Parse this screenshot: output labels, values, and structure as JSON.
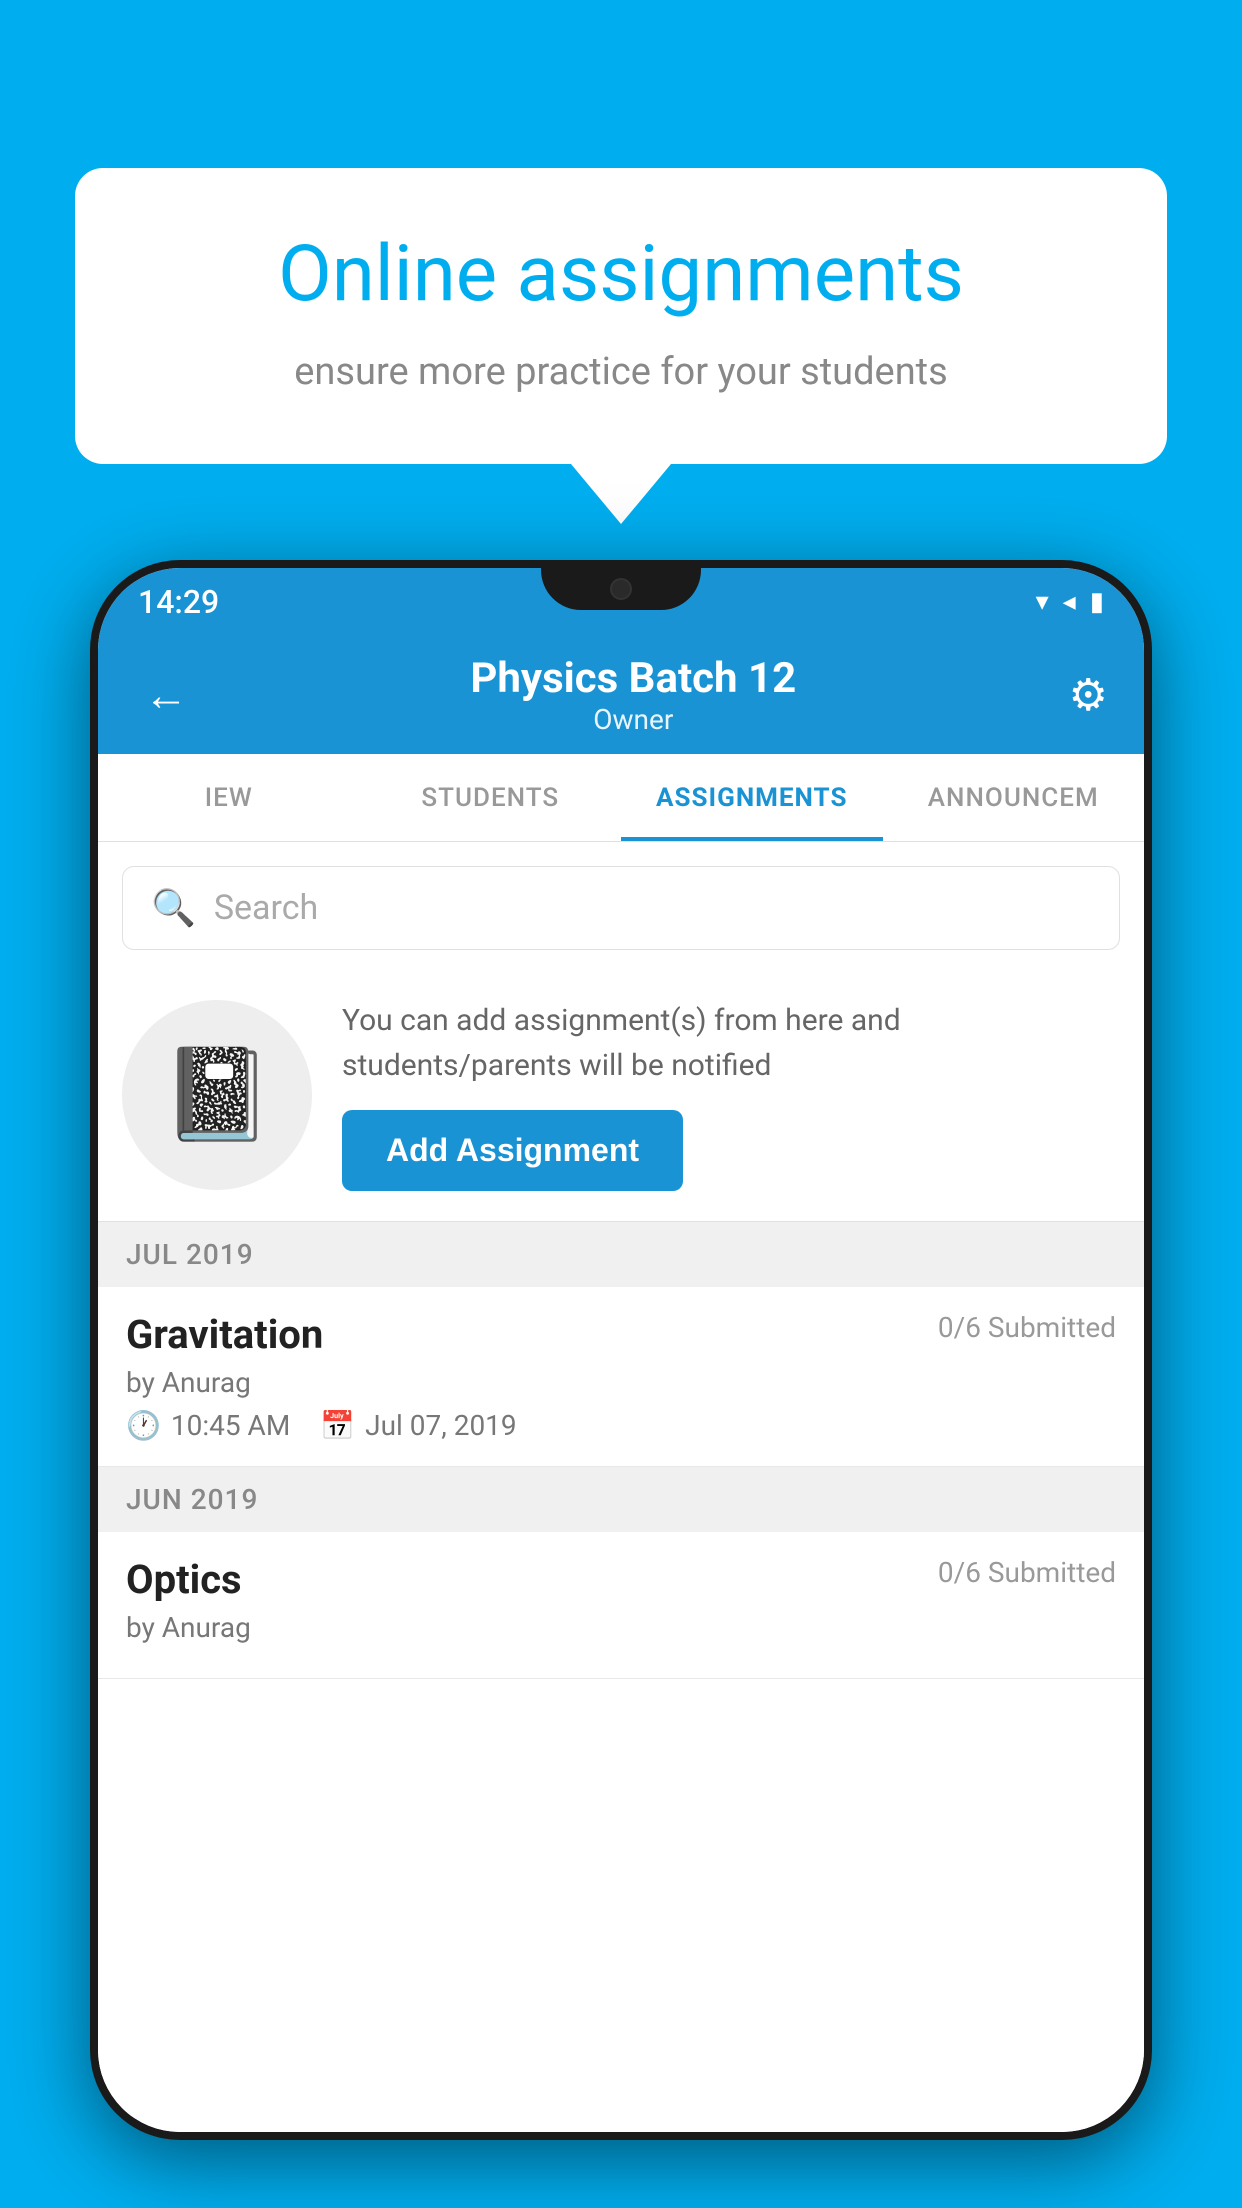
{
  "background_color": "#00AEEF",
  "speech_bubble": {
    "title": "Online assignments",
    "subtitle": "ensure more practice for your students"
  },
  "status_bar": {
    "time": "14:29",
    "icons": [
      "wifi",
      "signal",
      "battery"
    ]
  },
  "app_header": {
    "title": "Physics Batch 12",
    "subtitle": "Owner",
    "back_label": "←",
    "settings_label": "⚙"
  },
  "tabs": [
    {
      "label": "IEW",
      "active": false
    },
    {
      "label": "STUDENTS",
      "active": false
    },
    {
      "label": "ASSIGNMENTS",
      "active": true
    },
    {
      "label": "ANNOUNCEM",
      "active": false
    }
  ],
  "search": {
    "placeholder": "Search"
  },
  "promo": {
    "description": "You can add assignment(s) from here and students/parents will be notified",
    "button_label": "Add Assignment"
  },
  "sections": [
    {
      "header": "JUL 2019",
      "assignments": [
        {
          "name": "Gravitation",
          "submitted": "0/6 Submitted",
          "by": "by Anurag",
          "time": "10:45 AM",
          "date": "Jul 07, 2019"
        }
      ]
    },
    {
      "header": "JUN 2019",
      "assignments": [
        {
          "name": "Optics",
          "submitted": "0/6 Submitted",
          "by": "by Anurag",
          "time": "",
          "date": ""
        }
      ]
    }
  ]
}
